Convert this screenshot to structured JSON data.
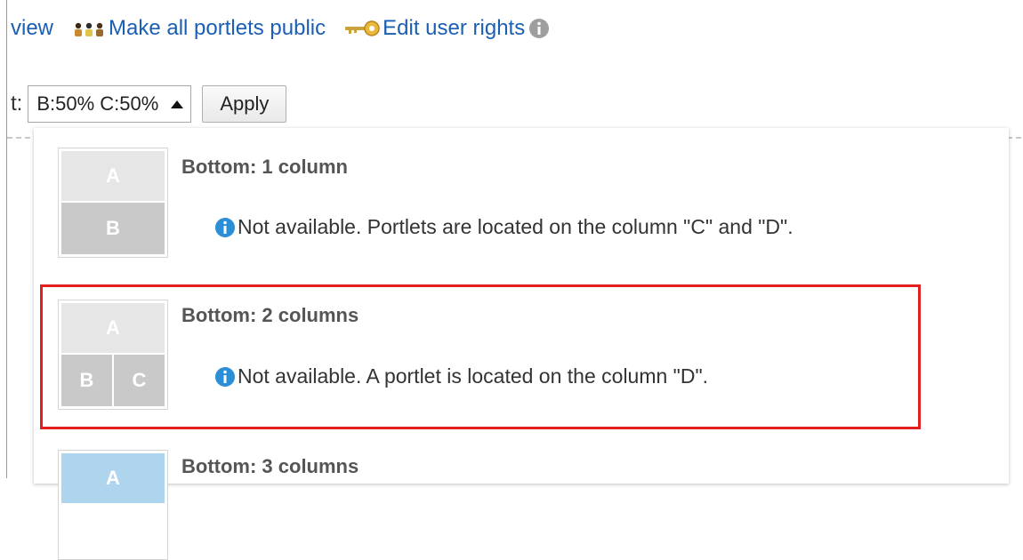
{
  "toolbar": {
    "view_label": "view",
    "make_public_label": "Make all portlets public",
    "edit_rights_label": "Edit user rights",
    "icons": [
      "people-icon",
      "key-icon",
      "info-icon"
    ]
  },
  "layout": {
    "label": "t:",
    "selected": "B:50% C:50%",
    "apply_label": "Apply"
  },
  "options": [
    {
      "title": "Bottom: 1 column",
      "note": "Not available. Portlets are located on the column \"C\" and \"D\".",
      "cells": [
        "A",
        "B"
      ]
    },
    {
      "title": "Bottom: 2 columns",
      "note": "Not available. A portlet is located on the column \"D\".",
      "cells": [
        "A",
        "B",
        "C"
      ]
    },
    {
      "title": "Bottom: 3 columns",
      "cells": [
        "A"
      ]
    }
  ],
  "colors": {
    "link": "#1a5fb4",
    "highlight": "#e32020",
    "info_blue": "#2a8fd6",
    "thumb_blue": "#aed4ee"
  }
}
